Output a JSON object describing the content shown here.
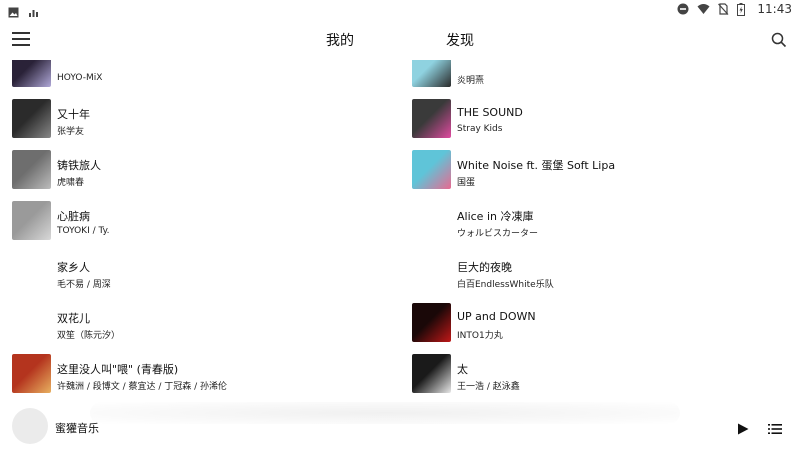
{
  "status_bar": {
    "time": "11:43",
    "left_icons": [
      "image-icon",
      "signal-bars-icon"
    ],
    "right_icons": [
      "do-not-disturb-icon",
      "wifi-icon",
      "no-sim-icon",
      "battery-icon"
    ]
  },
  "header": {
    "tabs": [
      {
        "label": "我的",
        "selected": true
      },
      {
        "label": "发现",
        "selected": false
      }
    ],
    "menu_icon": "menu-icon",
    "search_icon": "search-icon"
  },
  "songs_left": [
    {
      "title": "",
      "artist": "HOYO-MiX",
      "cover": "#2a2238",
      "cover2": "#b0a8d8"
    },
    {
      "title": "又十年",
      "artist": "张学友",
      "cover": "#2b2b2b",
      "cover2": "#888888"
    },
    {
      "title": "铸铁旅人",
      "artist": "虎啸春",
      "cover": "#6e6e6e",
      "cover2": "#bdbdbd"
    },
    {
      "title": "心脏病",
      "artist": "TOYOKI / Ty.",
      "cover": "#9a9a9a",
      "cover2": "#d8d8d8"
    },
    {
      "title": "家乡人",
      "artist": "毛不易 / 周深",
      "cover": null,
      "cover2": null
    },
    {
      "title": "双花儿",
      "artist": "双笙（陈元汐）",
      "cover": null,
      "cover2": null
    },
    {
      "title": "这里没人叫\"喂\" (青春版)",
      "artist": "许魏洲 / 段博文 / 蔡宜达 / 丁冠森 / 孙浠伦",
      "cover": "#b4341e",
      "cover2": "#e8b060"
    }
  ],
  "songs_right": [
    {
      "title": "",
      "artist": "炎明熹",
      "cover": "#8fd2e0",
      "cover2": "#2a2a2a"
    },
    {
      "title": "THE SOUND",
      "artist": "Stray Kids",
      "cover": "#3a3a3a",
      "cover2": "#e04aa0"
    },
    {
      "title": "White Noise ft. 蛋堡 Soft Lipa",
      "artist": "国蛋",
      "cover": "#5fc4d8",
      "cover2": "#e86a90"
    },
    {
      "title": "Alice in 冷凍庫",
      "artist": "ウォルビスカーター",
      "cover": null,
      "cover2": null
    },
    {
      "title": "巨大的夜晚",
      "artist": "白百EndlessWhite乐队",
      "cover": null,
      "cover2": null
    },
    {
      "title": "UP and DOWN",
      "artist": "INTO1力丸",
      "cover": "#1a0808",
      "cover2": "#c01818"
    },
    {
      "title": "太",
      "artist": "王一浩 / 赵泳鑫",
      "cover": "#1a1a1a",
      "cover2": "#e8e8e8"
    }
  ],
  "player": {
    "title": "蜜獾音乐",
    "play_icon": "play-icon",
    "queue_icon": "queue-list-icon"
  }
}
